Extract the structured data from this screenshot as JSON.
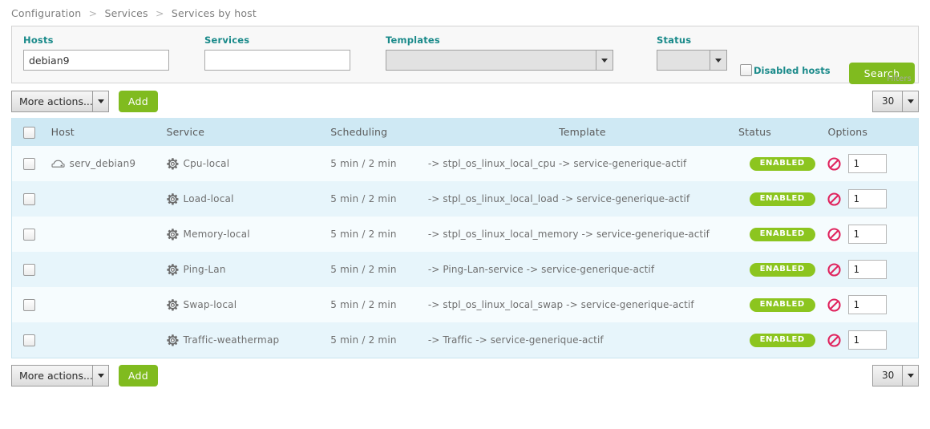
{
  "breadcrumb": {
    "items": [
      "Configuration",
      "Services",
      "Services by host"
    ],
    "separator": ">"
  },
  "filters": {
    "hosts": {
      "label": "Hosts",
      "value": "debian9",
      "placeholder": ""
    },
    "services": {
      "label": "Services",
      "value": "",
      "placeholder": ""
    },
    "templates": {
      "label": "Templates",
      "selected": ""
    },
    "status": {
      "label": "Status",
      "selected": ""
    },
    "disabled_hosts": {
      "label": "Disabled hosts",
      "checked": false
    },
    "search_button": "Search",
    "caption": "Filters"
  },
  "toolbar_top": {
    "more_actions": "More actions...",
    "add_button": "Add",
    "page_size": "30"
  },
  "toolbar_bottom": {
    "more_actions": "More actions...",
    "add_button": "Add",
    "page_size": "30"
  },
  "table": {
    "columns": [
      "Host",
      "Service",
      "Scheduling",
      "Template",
      "Status",
      "Options"
    ],
    "rows": [
      {
        "host": "serv_debian9",
        "host_icon": "server-icon",
        "service": "Cpu-local",
        "service_icon": "gear-icon",
        "scheduling": "5 min / 2 min",
        "template": "-> stpl_os_linux_local_cpu -> service-generique-actif",
        "status": "ENABLED",
        "disable_icon": "no-entry-icon",
        "option_value": "1"
      },
      {
        "host": "",
        "host_icon": "",
        "service": "Load-local",
        "service_icon": "gear-icon",
        "scheduling": "5 min / 2 min",
        "template": "-> stpl_os_linux_local_load -> service-generique-actif",
        "status": "ENABLED",
        "disable_icon": "no-entry-icon",
        "option_value": "1"
      },
      {
        "host": "",
        "host_icon": "",
        "service": "Memory-local",
        "service_icon": "gear-icon",
        "scheduling": "5 min / 2 min",
        "template": "-> stpl_os_linux_local_memory -> service-generique-actif",
        "status": "ENABLED",
        "disable_icon": "no-entry-icon",
        "option_value": "1"
      },
      {
        "host": "",
        "host_icon": "",
        "service": "Ping-Lan",
        "service_icon": "gear-icon",
        "scheduling": "5 min / 2 min",
        "template": "-> Ping-Lan-service -> service-generique-actif",
        "status": "ENABLED",
        "disable_icon": "no-entry-icon",
        "option_value": "1"
      },
      {
        "host": "",
        "host_icon": "",
        "service": "Swap-local",
        "service_icon": "gear-icon",
        "scheduling": "5 min / 2 min",
        "template": "-> stpl_os_linux_local_swap -> service-generique-actif",
        "status": "ENABLED",
        "disable_icon": "no-entry-icon",
        "option_value": "1"
      },
      {
        "host": "",
        "host_icon": "",
        "service": "Traffic-weathermap",
        "service_icon": "gear-icon",
        "scheduling": "5 min / 2 min",
        "template": "-> Traffic -> service-generique-actif",
        "status": "ENABLED",
        "disable_icon": "no-entry-icon",
        "option_value": "1"
      }
    ]
  },
  "colors": {
    "accent_green": "#80bb1f",
    "badge_green": "#8cc51f",
    "label_teal": "#1a8a8a",
    "header_blue": "#cfe9f4",
    "row_odd": "#f6fcfe",
    "row_even": "#e7f5fb",
    "disable_red": "#e0245e"
  }
}
